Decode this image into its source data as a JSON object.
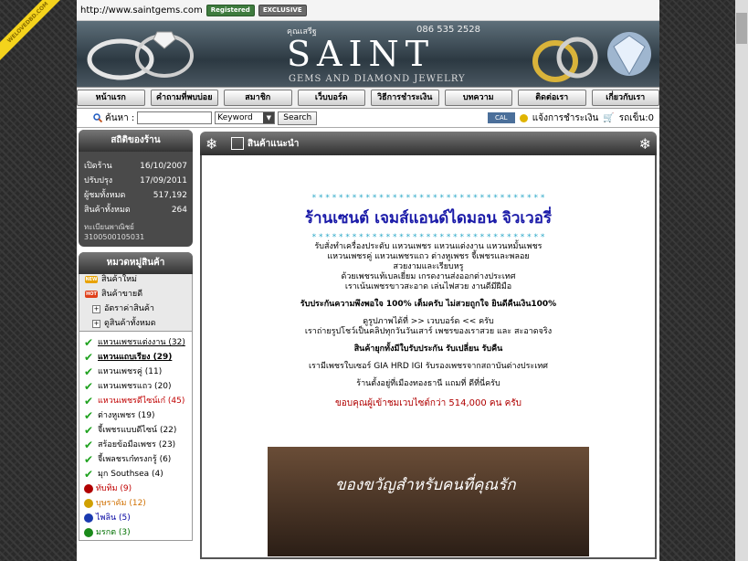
{
  "site": {
    "url": "http://www.saintgems.com",
    "badge_registered": "Registered",
    "badge_exclusive": "EXCLUSIVE",
    "ribbon": "WELOVEDBD.COM"
  },
  "banner": {
    "owner_small": "คุณเสรีฐ",
    "brand": "SAINT",
    "phone": "086 535 2528",
    "tagline": "GEMS AND DIAMOND JEWELRY"
  },
  "nav": {
    "items": [
      "หน้าแรก",
      "คำถามที่พบบ่อย",
      "สมาชิก",
      "เว็บบอร์ด",
      "วิธีการชำระเงิน",
      "บทความ",
      "ติดต่อเรา",
      "เกี่ยวกับเรา"
    ]
  },
  "search": {
    "label": "ค้นหา :",
    "value": "",
    "select_value": "Keyword",
    "button_label": "Search",
    "cal_label": "CAL",
    "payment_label": "แจ้งการชำระเงิน",
    "cart_label": "รถเข็น:0"
  },
  "stats": {
    "title": "สถิติของร้าน",
    "rows": [
      {
        "label": "เปิดร้าน",
        "value": "16/10/2007"
      },
      {
        "label": "ปรับปรุง",
        "value": "17/09/2011"
      },
      {
        "label": "ผู้ชมทั้งหมด",
        "value": "517,192"
      },
      {
        "label": "สินค้าทั้งหมด",
        "value": "264"
      }
    ],
    "dbd_label": "ทะเบียนพาณิชย์",
    "dbd_number": "3100500105031"
  },
  "categories": {
    "title": "หมวดหมู่สินค้า",
    "menu": [
      {
        "tag": "NEW",
        "label": "สินค้าใหม่"
      },
      {
        "tag": "HOT",
        "label": "สินค้าขายดี"
      },
      {
        "tag": "+",
        "label": "อัตราค่าสินค้า"
      },
      {
        "tag": "+",
        "label": "ดูสินค้าทั้งหมด"
      }
    ],
    "products": [
      {
        "label": "แหวนเพชรแต่งงาน (32)",
        "color": "#000000",
        "icon": "check"
      },
      {
        "label": "แหวนแถบเรียง (29)",
        "color": "#000000",
        "icon": "check"
      },
      {
        "label": "แหวนเพชรคู่ (11)",
        "color": "#000000",
        "icon": "check"
      },
      {
        "label": "แหวนเพชรแถว (20)",
        "color": "#000000",
        "icon": "check"
      },
      {
        "label": "แหวนเพชรดีไซน์เก๋ (45)",
        "color": "#c00000",
        "icon": "check"
      },
      {
        "label": "ต่างหูเพชร (19)",
        "color": "#000000",
        "icon": "check"
      },
      {
        "label": "จี้เพชรแบบดีไซน์ (22)",
        "color": "#000000",
        "icon": "check"
      },
      {
        "label": "สร้อยข้อมือเพชร (23)",
        "color": "#000000",
        "icon": "check"
      },
      {
        "label": "จี้เพลชรเก๋ทรงกรู้ (6)",
        "color": "#000000",
        "icon": "check"
      },
      {
        "label": "มุก Southsea (4)",
        "color": "#000000",
        "icon": "check"
      },
      {
        "label": "ทับทิม (9)",
        "color": "#c00000",
        "icon": "dot-red"
      },
      {
        "label": "บุษราคัม (12)",
        "color": "#d07000",
        "icon": "dot-yellow"
      },
      {
        "label": "ไพลิน (5)",
        "color": "#0000a0",
        "icon": "dot-blue"
      },
      {
        "label": "มรกต (3)",
        "color": "#007000",
        "icon": "dot-green"
      }
    ]
  },
  "main": {
    "section_title": "สินค้าแนะนำ",
    "stars": "* * * * * * * * * * * * * * * * * * * * * * * * * * * * * * * * * * *",
    "shop_name": "ร้านเซนต์ เจมส์แอนด์ไดมอน จิวเวอรี่",
    "intro": [
      "รับสั่งทำเครื่องประดับ แหวนเพชร แหวนแต่งงาน แหวนหมั้นเพชร",
      "แหวนเพชรคู่ แหวนเพชรแถว ต่างหูเพชร จี้เพชรและพลอย",
      "สวยงามและเรียบหรู",
      "ด้วยเพชรแท้เบลเยี่ยม เกรดงานส่งออกต่างประเทศ",
      "เราเน้นเพชรขาวสะอาด เล่นไฟสวย งานดีมีฝีมือ"
    ],
    "guarantee": "รับประกันความพึงพอใจ 100% เต็มครับ ไม่สวยถูกใจ ยินดีคืนเงิน100%",
    "webboard": [
      "ดูรูปภาพได้ที่ >> เวบบอร์ด << ครับ",
      "เราถ่ายรูปโชว์เป็นคลิปทุกวันวันเสาร์ เพชรของเราสวย และ สะอาดจริง"
    ],
    "trade": "สินค้ายุกทั้งมีใบรับประกัน รับเปลี่ยน รับคืน",
    "cert": "เรามีเพชรใบเซอร์ GIA HRD IGI รับรองเพชรจากสถาบันต่างประเทศ",
    "location": "ร้านตั้งอยู่ที่เมืองทองธานี แถมที่ ดีที่นี่ครับ",
    "thanks": "ขอบคุณผู้เข้าชมเวบไซต์กว่า 514,000 คน ครับ",
    "photo_caption": "ของขวัญสำหรับคนที่คุณรัก"
  },
  "colors": {
    "accent": "#1a1aa8",
    "stars": "#2aa8c8",
    "thanks": "#b00000"
  }
}
